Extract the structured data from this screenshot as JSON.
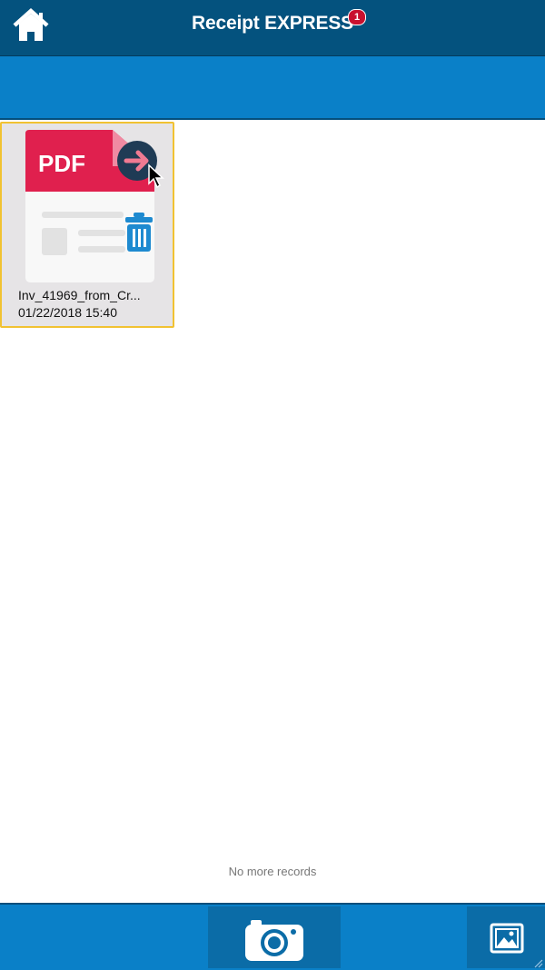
{
  "header": {
    "title": "Receipt EXPRESS",
    "badge_count": "1",
    "home_icon": "home-icon"
  },
  "files": [
    {
      "name": "Inv_41969_from_Cr...",
      "datetime": "01/22/2018 15:40",
      "type_label": "PDF",
      "icons": [
        "pdf-document-icon",
        "share-arrow-icon",
        "trash-icon"
      ]
    }
  ],
  "status": {
    "no_more_records": "No more records"
  },
  "footer": {
    "camera_icon": "camera-icon",
    "gallery_icon": "image-gallery-icon"
  },
  "colors": {
    "header_bg": "#04527e",
    "bar_bg": "#0a80c8",
    "pdf_red": "#e0204e",
    "trash_blue": "#1e8ad0",
    "selection_border": "#f1c232",
    "badge_red": "#c8102e"
  }
}
